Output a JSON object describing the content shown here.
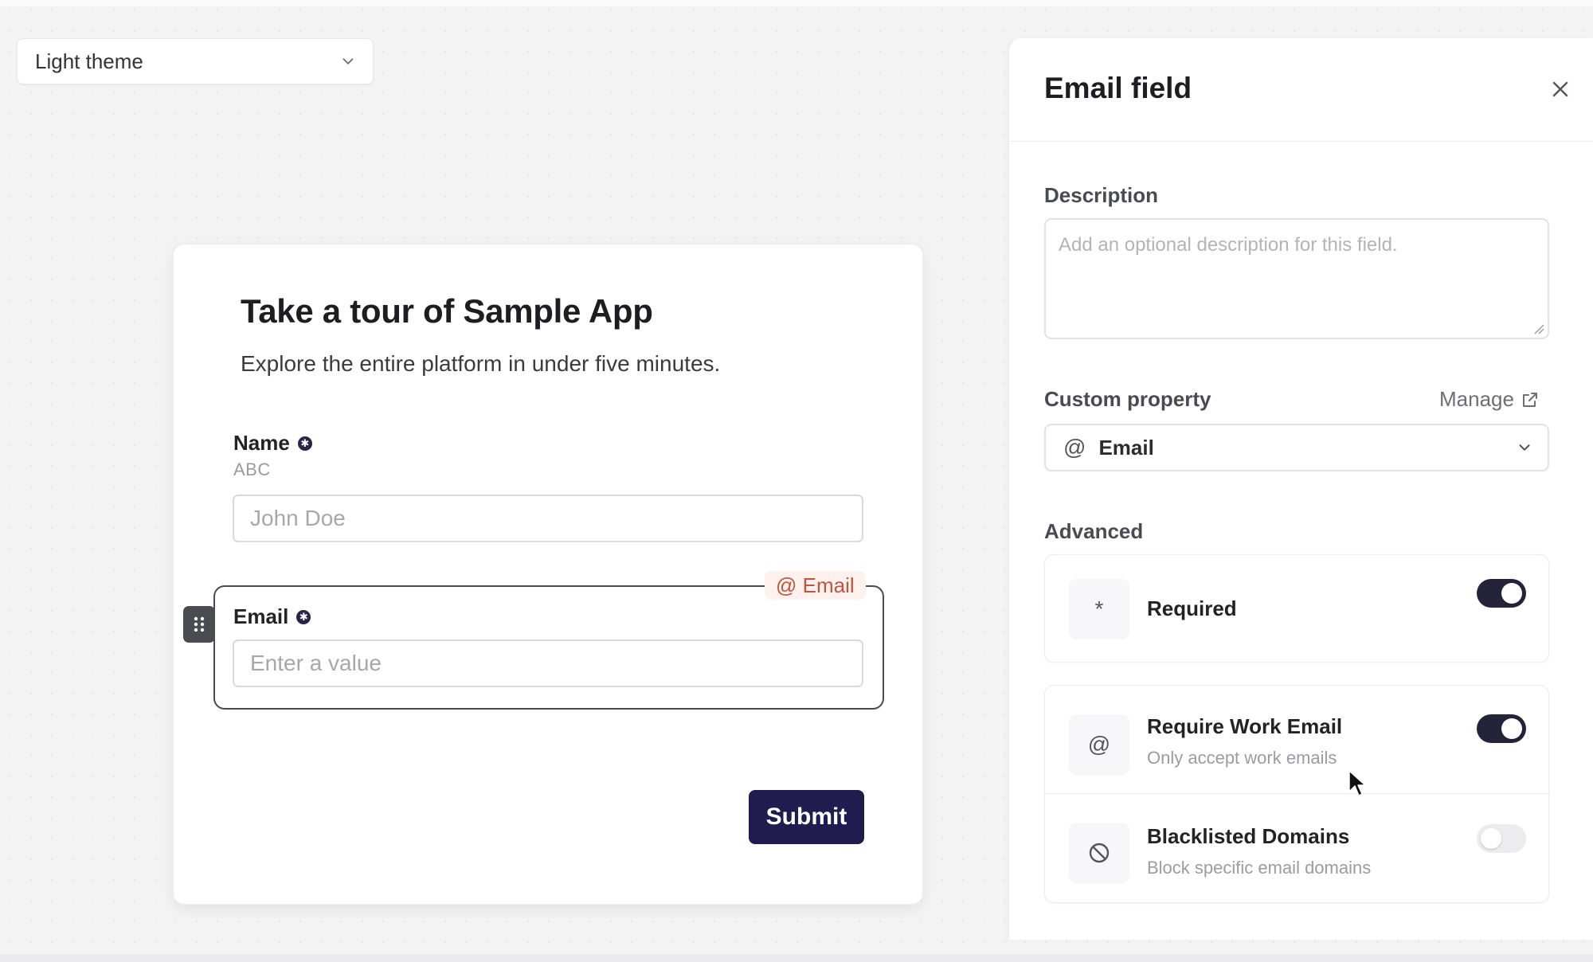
{
  "theme_selector": {
    "value": "Light theme",
    "icon": "chevron-down-icon"
  },
  "form": {
    "title": "Take a tour of Sample App",
    "subtitle": "Explore the entire platform in under five minutes.",
    "fields": [
      {
        "label": "Name",
        "required": true,
        "hint": "ABC",
        "placeholder": "John Doe"
      },
      {
        "label": "Email",
        "required": true,
        "type_tag": "@ Email",
        "placeholder": "Enter a value",
        "selected": true
      }
    ],
    "submit_label": "Submit"
  },
  "panel": {
    "title": "Email field",
    "description": {
      "label": "Description",
      "placeholder": "Add an optional description for this field."
    },
    "custom_property": {
      "label": "Custom property",
      "manage_label": "Manage",
      "value": "Email",
      "icon_glyph": "@"
    },
    "advanced": {
      "label": "Advanced",
      "items": [
        {
          "title": "Required",
          "subtitle": "",
          "icon": "asterisk-icon",
          "glyph": "*",
          "enabled": true
        },
        {
          "title": "Require Work Email",
          "subtitle": "Only accept work emails",
          "icon": "at-sign-icon",
          "glyph": "@",
          "enabled": true
        },
        {
          "title": "Blacklisted Domains",
          "subtitle": "Block specific email domains",
          "icon": "block-icon",
          "glyph": "⃠",
          "enabled": false
        }
      ]
    }
  },
  "colors": {
    "accent": "#211c4f",
    "toggle_on": "#25233a",
    "tag_text": "#c3533e",
    "tag_bg": "#fff2ee"
  }
}
